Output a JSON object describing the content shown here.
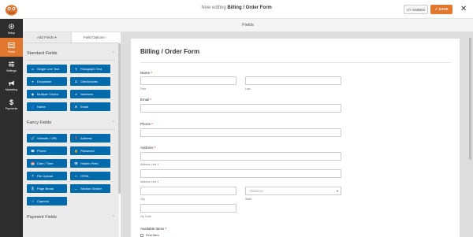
{
  "header": {
    "editing_prefix": "Now editing",
    "form_name": "Billing / Order Form",
    "embed_label": "</> EMBED",
    "save_label": "✓ SAVE",
    "close_label": "✕"
  },
  "sidebar": {
    "items": [
      {
        "label": "Setup",
        "icon": "gear-icon"
      },
      {
        "label": "Fields",
        "icon": "fields-icon"
      },
      {
        "label": "Settings",
        "icon": "sliders-icon"
      },
      {
        "label": "Marketing",
        "icon": "megaphone-icon"
      },
      {
        "label": "Payments",
        "icon": "dollar-icon"
      }
    ],
    "active": "Fields"
  },
  "subheader": {
    "title": "Fields"
  },
  "panel": {
    "tabs": [
      {
        "label": "Add Fields ▾"
      },
      {
        "label": "Field Options ›"
      }
    ],
    "standard": {
      "title": "Standard Fields",
      "chevron": "⌃",
      "buttons": [
        {
          "label": "Single Line Text",
          "icon": "▭"
        },
        {
          "label": "Paragraph Text",
          "icon": "¶"
        },
        {
          "label": "Dropdown",
          "icon": "▾"
        },
        {
          "label": "Checkboxes",
          "icon": "☑"
        },
        {
          "label": "Multiple Choice",
          "icon": "◉"
        },
        {
          "label": "Numbers",
          "icon": "#"
        },
        {
          "label": "Name",
          "icon": "👤"
        },
        {
          "label": "Email",
          "icon": "✉"
        }
      ]
    },
    "fancy": {
      "title": "Fancy Fields",
      "chevron": "⌃",
      "buttons": [
        {
          "label": "Website / URL",
          "icon": "🔗"
        },
        {
          "label": "Address",
          "icon": "📍"
        },
        {
          "label": "Phone",
          "icon": "☎"
        },
        {
          "label": "Password",
          "icon": "🔒"
        },
        {
          "label": "Date / Time",
          "icon": "📅"
        },
        {
          "label": "Hidden Field",
          "icon": "👁"
        },
        {
          "label": "File Upload",
          "icon": "⤒"
        },
        {
          "label": "HTML",
          "icon": "‹›"
        },
        {
          "label": "Page Break",
          "icon": "⎘"
        },
        {
          "label": "Section Divider",
          "icon": "―"
        },
        {
          "label": "Captcha",
          "icon": "?"
        }
      ]
    },
    "payment": {
      "title": "Payment Fields",
      "chevron": "⌃"
    }
  },
  "form": {
    "title": "Billing / Order Form",
    "name_label": "Name",
    "first_label": "First",
    "last_label": "Last",
    "email_label": "Email",
    "phone_label": "Phone",
    "address_label": "Address",
    "address1_label": "Address Line 1",
    "address2_label": "Address Line 2",
    "city_label": "City",
    "state_label": "State",
    "state_value": "Alabama",
    "zip_label": "Zip Code",
    "items_label": "Available Items",
    "first_item": "First Item",
    "required_mark": "*"
  },
  "colors": {
    "accent": "#e27730",
    "field_button": "#036aab",
    "sidebar": "#2d2d2d"
  }
}
